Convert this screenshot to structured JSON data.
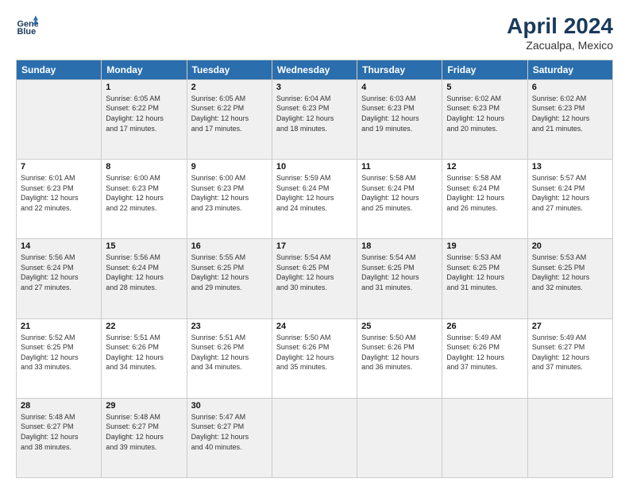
{
  "header": {
    "logo_line1": "General",
    "logo_line2": "Blue",
    "title": "April 2024",
    "subtitle": "Zacualpa, Mexico"
  },
  "weekdays": [
    "Sunday",
    "Monday",
    "Tuesday",
    "Wednesday",
    "Thursday",
    "Friday",
    "Saturday"
  ],
  "weeks": [
    [
      {
        "day": "",
        "info": ""
      },
      {
        "day": "1",
        "info": "Sunrise: 6:05 AM\nSunset: 6:22 PM\nDaylight: 12 hours\nand 17 minutes."
      },
      {
        "day": "2",
        "info": "Sunrise: 6:05 AM\nSunset: 6:22 PM\nDaylight: 12 hours\nand 17 minutes."
      },
      {
        "day": "3",
        "info": "Sunrise: 6:04 AM\nSunset: 6:23 PM\nDaylight: 12 hours\nand 18 minutes."
      },
      {
        "day": "4",
        "info": "Sunrise: 6:03 AM\nSunset: 6:23 PM\nDaylight: 12 hours\nand 19 minutes."
      },
      {
        "day": "5",
        "info": "Sunrise: 6:02 AM\nSunset: 6:23 PM\nDaylight: 12 hours\nand 20 minutes."
      },
      {
        "day": "6",
        "info": "Sunrise: 6:02 AM\nSunset: 6:23 PM\nDaylight: 12 hours\nand 21 minutes."
      }
    ],
    [
      {
        "day": "7",
        "info": "Sunrise: 6:01 AM\nSunset: 6:23 PM\nDaylight: 12 hours\nand 22 minutes."
      },
      {
        "day": "8",
        "info": "Sunrise: 6:00 AM\nSunset: 6:23 PM\nDaylight: 12 hours\nand 22 minutes."
      },
      {
        "day": "9",
        "info": "Sunrise: 6:00 AM\nSunset: 6:23 PM\nDaylight: 12 hours\nand 23 minutes."
      },
      {
        "day": "10",
        "info": "Sunrise: 5:59 AM\nSunset: 6:24 PM\nDaylight: 12 hours\nand 24 minutes."
      },
      {
        "day": "11",
        "info": "Sunrise: 5:58 AM\nSunset: 6:24 PM\nDaylight: 12 hours\nand 25 minutes."
      },
      {
        "day": "12",
        "info": "Sunrise: 5:58 AM\nSunset: 6:24 PM\nDaylight: 12 hours\nand 26 minutes."
      },
      {
        "day": "13",
        "info": "Sunrise: 5:57 AM\nSunset: 6:24 PM\nDaylight: 12 hours\nand 27 minutes."
      }
    ],
    [
      {
        "day": "14",
        "info": "Sunrise: 5:56 AM\nSunset: 6:24 PM\nDaylight: 12 hours\nand 27 minutes."
      },
      {
        "day": "15",
        "info": "Sunrise: 5:56 AM\nSunset: 6:24 PM\nDaylight: 12 hours\nand 28 minutes."
      },
      {
        "day": "16",
        "info": "Sunrise: 5:55 AM\nSunset: 6:25 PM\nDaylight: 12 hours\nand 29 minutes."
      },
      {
        "day": "17",
        "info": "Sunrise: 5:54 AM\nSunset: 6:25 PM\nDaylight: 12 hours\nand 30 minutes."
      },
      {
        "day": "18",
        "info": "Sunrise: 5:54 AM\nSunset: 6:25 PM\nDaylight: 12 hours\nand 31 minutes."
      },
      {
        "day": "19",
        "info": "Sunrise: 5:53 AM\nSunset: 6:25 PM\nDaylight: 12 hours\nand 31 minutes."
      },
      {
        "day": "20",
        "info": "Sunrise: 5:53 AM\nSunset: 6:25 PM\nDaylight: 12 hours\nand 32 minutes."
      }
    ],
    [
      {
        "day": "21",
        "info": "Sunrise: 5:52 AM\nSunset: 6:25 PM\nDaylight: 12 hours\nand 33 minutes."
      },
      {
        "day": "22",
        "info": "Sunrise: 5:51 AM\nSunset: 6:26 PM\nDaylight: 12 hours\nand 34 minutes."
      },
      {
        "day": "23",
        "info": "Sunrise: 5:51 AM\nSunset: 6:26 PM\nDaylight: 12 hours\nand 34 minutes."
      },
      {
        "day": "24",
        "info": "Sunrise: 5:50 AM\nSunset: 6:26 PM\nDaylight: 12 hours\nand 35 minutes."
      },
      {
        "day": "25",
        "info": "Sunrise: 5:50 AM\nSunset: 6:26 PM\nDaylight: 12 hours\nand 36 minutes."
      },
      {
        "day": "26",
        "info": "Sunrise: 5:49 AM\nSunset: 6:26 PM\nDaylight: 12 hours\nand 37 minutes."
      },
      {
        "day": "27",
        "info": "Sunrise: 5:49 AM\nSunset: 6:27 PM\nDaylight: 12 hours\nand 37 minutes."
      }
    ],
    [
      {
        "day": "28",
        "info": "Sunrise: 5:48 AM\nSunset: 6:27 PM\nDaylight: 12 hours\nand 38 minutes."
      },
      {
        "day": "29",
        "info": "Sunrise: 5:48 AM\nSunset: 6:27 PM\nDaylight: 12 hours\nand 39 minutes."
      },
      {
        "day": "30",
        "info": "Sunrise: 5:47 AM\nSunset: 6:27 PM\nDaylight: 12 hours\nand 40 minutes."
      },
      {
        "day": "",
        "info": ""
      },
      {
        "day": "",
        "info": ""
      },
      {
        "day": "",
        "info": ""
      },
      {
        "day": "",
        "info": ""
      }
    ]
  ],
  "shading": [
    true,
    false,
    true,
    false,
    true
  ]
}
